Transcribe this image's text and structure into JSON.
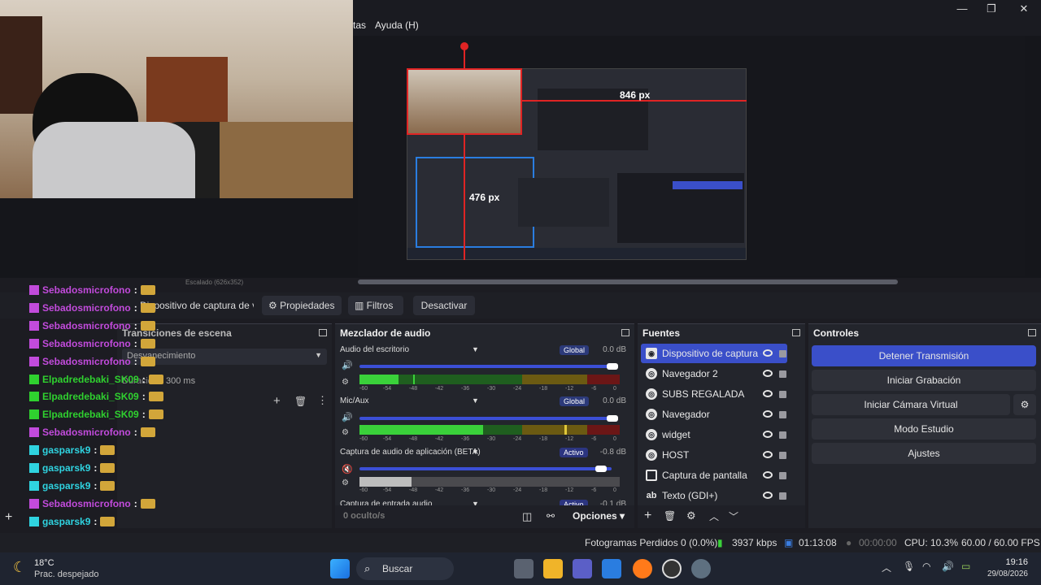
{
  "menu": {
    "partial_item": "tas",
    "help_item": "Ayuda (H)"
  },
  "window_controls": {
    "minimize": "—",
    "maximize": "❐",
    "close": "✕"
  },
  "preview": {
    "width_label": "846 px",
    "height_label": "476 px",
    "context_hint": "Escalado (626x352)"
  },
  "toolbar": {
    "source_name": "Dispositivo de captura de v",
    "properties": "Propiedades",
    "filters": "Filtros",
    "deactivate": "Desactivar"
  },
  "transitions": {
    "title": "Transiciones de escena",
    "type": "Desvanecimiento",
    "duration_label": "Duración",
    "duration_value": "300 ms"
  },
  "mixer": {
    "title": "Mezclador de audio",
    "channels": [
      {
        "name": "Audio del escritorio",
        "badge": "Global",
        "db": "0.0 dB"
      },
      {
        "name": "Mic/Aux",
        "badge": "Global",
        "db": "0.0 dB"
      },
      {
        "name": "Captura de audio de aplicación (BETA)",
        "badge": "Activo",
        "db": "-0.8 dB"
      },
      {
        "name": "Captura de entrada audio",
        "badge": "Activo",
        "db": "-0.1 dB"
      }
    ],
    "scale": [
      "-60",
      "-54",
      "-48",
      "-42",
      "-36",
      "-30",
      "-24",
      "-18",
      "-12",
      "-6",
      "0"
    ],
    "hidden_count": "0 oculto/s",
    "options": "Opciones"
  },
  "sources": {
    "title": "Fuentes",
    "items": [
      {
        "label": "Dispositivo de captura de v",
        "icon": "camera-icon"
      },
      {
        "label": "Navegador 2",
        "icon": "globe-icon"
      },
      {
        "label": "SUBS REGALADA",
        "icon": "globe-icon"
      },
      {
        "label": "Navegador",
        "icon": "globe-icon"
      },
      {
        "label": "widget",
        "icon": "globe-icon"
      },
      {
        "label": "HOST",
        "icon": "globe-icon"
      },
      {
        "label": "Captura de pantalla",
        "icon": "monitor-icon"
      },
      {
        "label": "Texto (GDI+)",
        "icon": "text-icon"
      }
    ]
  },
  "controls": {
    "title": "Controles",
    "stop_stream": "Detener Transmisión",
    "start_record": "Iniciar Grabación",
    "start_vcam": "Iniciar Cámara Virtual",
    "studio_mode": "Modo Estudio",
    "settings": "Ajustes"
  },
  "chat": {
    "messages": [
      {
        "user": "Sebadosmicrofono",
        "color": "#c24bdc"
      },
      {
        "user": "Sebadosmicrofono",
        "color": "#c24bdc"
      },
      {
        "user": "Sebadosmicrofono",
        "color": "#c24bdc"
      },
      {
        "user": "Sebadosmicrofono",
        "color": "#c24bdc"
      },
      {
        "user": "Sebadosmicrofono",
        "color": "#c24bdc"
      },
      {
        "user": "Elpadredebaki_SK09",
        "color": "#2fd12f"
      },
      {
        "user": "Elpadredebaki_SK09",
        "color": "#2fd12f"
      },
      {
        "user": "Elpadredebaki_SK09",
        "color": "#2fd12f"
      },
      {
        "user": "Sebadosmicrofono",
        "color": "#c24bdc"
      },
      {
        "user": "gasparsk9",
        "color": "#2fd3e0"
      },
      {
        "user": "gasparsk9",
        "color": "#2fd3e0"
      },
      {
        "user": "gasparsk9",
        "color": "#2fd3e0"
      },
      {
        "user": "Sebadosmicrofono",
        "color": "#c24bdc"
      },
      {
        "user": "gasparsk9",
        "color": "#2fd3e0"
      }
    ],
    "separator": ":",
    "faded_user": "gasparsk9"
  },
  "status": {
    "dropped_frames": "Fotogramas Perdidos 0 (0.0%)",
    "bitrate": "3937 kbps",
    "stream_time": "01:13:08",
    "record_time": "00:00:00",
    "cpu": "CPU: 10.3%",
    "fps": "60.00 / 60.00 FPS"
  },
  "taskbar": {
    "temperature": "18°C",
    "weather": "Prac. despejado",
    "search": "Buscar",
    "time": "19:16",
    "date": "29/08/2026"
  },
  "colors": {
    "accent": "#3a4fc9",
    "selection_red": "#e02424",
    "selection_blue": "#2a7de0"
  }
}
